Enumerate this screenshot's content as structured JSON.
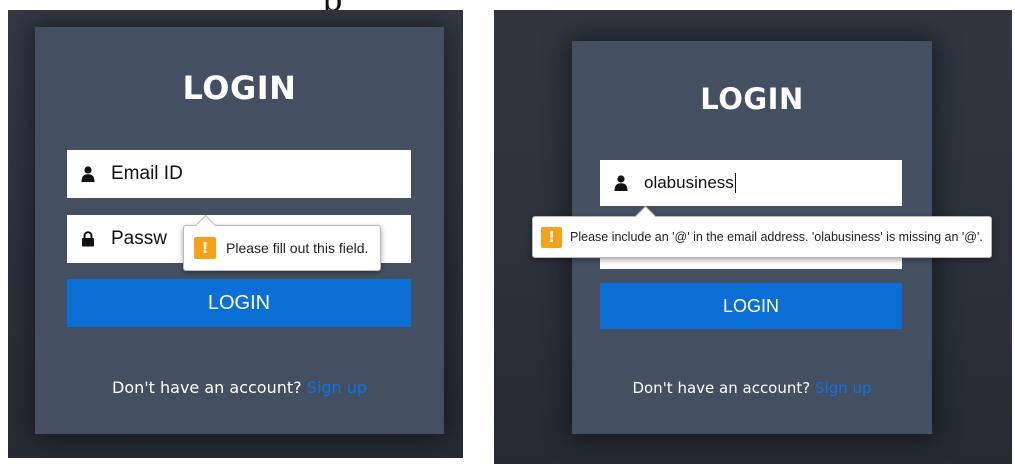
{
  "clipped_heading": "p",
  "left_screen": {
    "card_title": "LOGIN",
    "email_field": {
      "placeholder": "Email ID",
      "icon": "user-icon"
    },
    "password_field": {
      "visible_text": "Passw",
      "icon": "lock-icon"
    },
    "login_button": "LOGIN",
    "footer": {
      "text": "Don't have an account?",
      "link": "Sign up"
    },
    "validation_tooltip": {
      "icon": "warning-icon",
      "icon_glyph": "!",
      "message": "Please fill out this field."
    }
  },
  "right_screen": {
    "card_title": "LOGIN",
    "email_field": {
      "value": "olabusiness",
      "icon": "user-icon"
    },
    "login_button": "LOGIN",
    "footer": {
      "text": "Don't have an account?",
      "link": "Sign up"
    },
    "validation_tooltip": {
      "icon": "warning-icon",
      "icon_glyph": "!",
      "message": "Please include an '@' in the email address. 'olabusiness' is missing an '@'."
    }
  },
  "colors": {
    "background": "#2b313a",
    "card": "#445061",
    "button": "#0b6fd6",
    "link": "#0b72e3",
    "warning": "#f6a11a"
  }
}
